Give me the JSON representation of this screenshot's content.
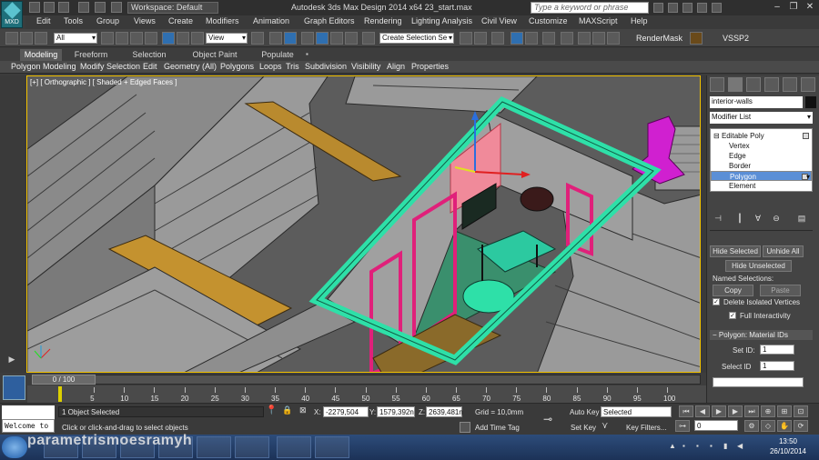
{
  "title_bar": {
    "logo_label": "MXD",
    "workspace": "Workspace: Default",
    "title": "Autodesk 3ds Max Design 2014 x64     23_start.max",
    "search_placeholder": "Type a keyword or phrase"
  },
  "menus": [
    "Edit",
    "Tools",
    "Group",
    "Views",
    "Create",
    "Modifiers",
    "Animation",
    "Graph Editors",
    "Rendering",
    "Lighting Analysis",
    "Civil View",
    "Customize",
    "MAXScript",
    "Help"
  ],
  "toolbar": {
    "selection_filter": "All",
    "reference_coord": "View",
    "named_selection": "Create Selection Se",
    "render_mask": "RenderMask",
    "vssp": "VSSP2"
  },
  "ribbon": {
    "tabs": [
      "Modeling",
      "Freeform",
      "Selection",
      "Object Paint",
      "Populate"
    ],
    "active_tab": "Modeling",
    "panels": [
      "Polygon Modeling",
      "Modify Selection",
      "Edit",
      "Geometry (All)",
      "Polygons",
      "Loops",
      "Tris",
      "Subdivision",
      "Visibility",
      "Align",
      "Properties"
    ]
  },
  "viewport": {
    "label": "[+] [ Orthographic ] [ Shaded + Edged Faces ]",
    "colors": {
      "border": "#f2c200",
      "walls": "#d9d9d9",
      "floor_wood": "#b98a2e",
      "selection": "#2ee0a8",
      "doors": "#e0207a",
      "pink_highlight": "#f08a9a",
      "chimney": "#d020d0"
    }
  },
  "command_panel": {
    "object_name": "interior-walls",
    "modifier_list": "Modifier List",
    "stack": [
      "Editable Poly",
      "Vertex",
      "Edge",
      "Border",
      "Polygon",
      "Element"
    ],
    "stack_selected": "Polygon",
    "hide_selected": "Hide Selected",
    "unhide_all": "Unhide All",
    "hide_unselected": "Hide Unselected",
    "named_selections": "Named Selections:",
    "copy": "Copy",
    "paste": "Paste",
    "delete_isolated": "Delete Isolated Vertices",
    "full_interactivity": "Full Interactivity",
    "material_ids_rollout": "Polygon: Material IDs",
    "set_id_label": "Set ID:",
    "set_id_value": "1",
    "select_id_label": "Select ID",
    "select_id_value": "1"
  },
  "timeline": {
    "frame_display": "0 / 100",
    "ticks": [
      "5",
      "10",
      "15",
      "20",
      "25",
      "30",
      "35",
      "40",
      "45",
      "50",
      "55",
      "60",
      "65",
      "70",
      "75",
      "80",
      "85",
      "90",
      "95",
      "100"
    ]
  },
  "status": {
    "maxscript_text": "Welcome to",
    "selection_info": "1 Object Selected",
    "prompt": "Click or click-and-drag to select objects",
    "x_label": "X:",
    "x_value": "-2279,504",
    "y_label": "Y:",
    "y_value": "1579,392n",
    "z_label": "Z:",
    "z_value": "2639,481n",
    "grid": "Grid = 10,0mm",
    "add_time_tag": "Add Time Tag",
    "auto_key": "Auto Key",
    "set_key": "Set Key",
    "key_mode": "Selected",
    "key_filters": "Key Filters...",
    "frame": "0"
  },
  "taskbar": {
    "watermark": "parametrismoesramyh",
    "time": "13:50",
    "date": "26/10/2014"
  }
}
